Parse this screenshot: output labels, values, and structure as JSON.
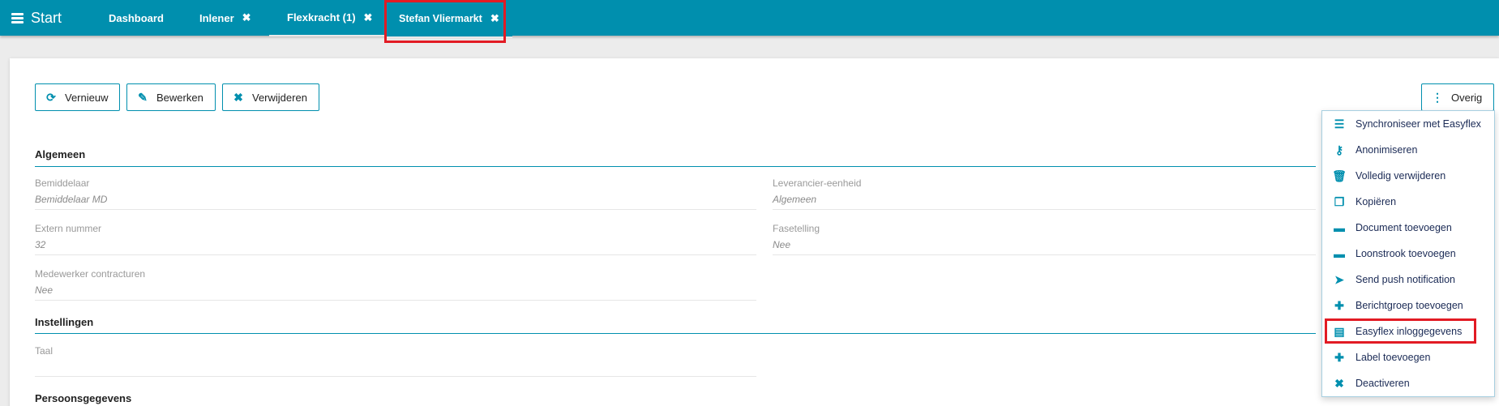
{
  "topbar": {
    "start_label": "Start",
    "tabs": [
      {
        "label": "Dashboard",
        "closable": false
      },
      {
        "label": "Inlener",
        "closable": true
      },
      {
        "label": "Flexkracht (1)",
        "closable": true
      },
      {
        "label": "Stefan Vliermarkt",
        "closable": true
      }
    ],
    "close_glyph": "✖"
  },
  "toolbar": {
    "refresh_label": "Vernieuw",
    "edit_label": "Bewerken",
    "delete_label": "Verwijderen",
    "more_label": "Overig"
  },
  "sections": {
    "algemeen": {
      "title": "Algemeen",
      "fields": [
        {
          "label": "Bemiddelaar",
          "value": "Bemiddelaar MD"
        },
        {
          "label": "Leverancier-eenheid",
          "value": "Algemeen"
        },
        {
          "label": "Extern nummer",
          "value": "32"
        },
        {
          "label": "Fasetelling",
          "value": "Nee"
        },
        {
          "label": "Medewerker contracturen",
          "value": "Nee"
        }
      ]
    },
    "instellingen": {
      "title": "Instellingen",
      "fields": [
        {
          "label": "Taal",
          "value": ""
        }
      ]
    },
    "persoonsgegevens": {
      "title": "Persoonsgegevens"
    }
  },
  "menu": {
    "items": [
      {
        "label": "Synchroniseer met Easyflex",
        "icon": "list-icon"
      },
      {
        "label": "Anonimiseren",
        "icon": "key-icon"
      },
      {
        "label": "Volledig verwijderen",
        "icon": "trash-icon"
      },
      {
        "label": "Kopiëren",
        "icon": "copy-icon"
      },
      {
        "label": "Document toevoegen",
        "icon": "folder-icon"
      },
      {
        "label": "Loonstrook toevoegen",
        "icon": "folder-icon"
      },
      {
        "label": "Send push notification",
        "icon": "paper-plane-icon"
      },
      {
        "label": "Berichtgroep toevoegen",
        "icon": "plus-icon"
      },
      {
        "label": "Easyflex inloggegevens",
        "icon": "id-card-icon",
        "highlighted": true
      },
      {
        "label": "Label toevoegen",
        "icon": "plus-icon"
      },
      {
        "label": "Deactiveren",
        "icon": "close-icon"
      }
    ]
  },
  "colors": {
    "brand": "#008fae",
    "highlight": "#e21b24"
  }
}
